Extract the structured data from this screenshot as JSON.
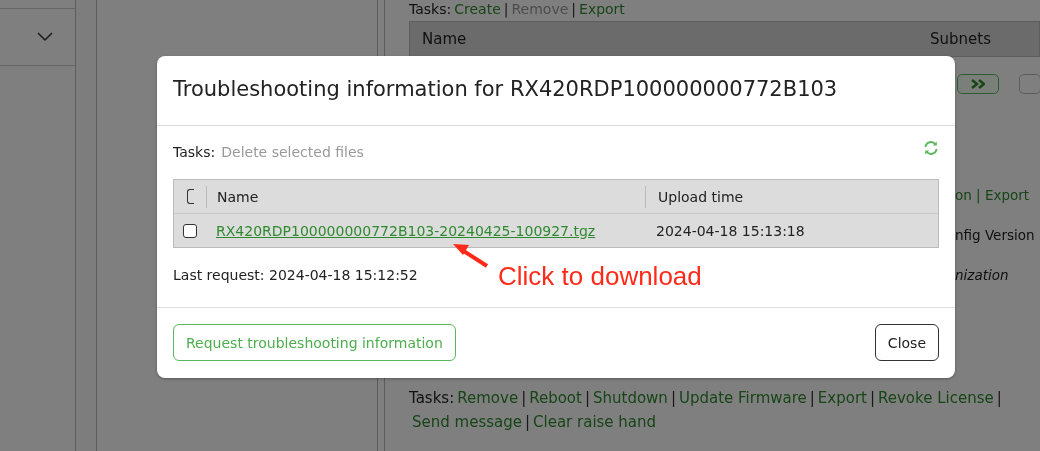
{
  "background": {
    "top_tasks": {
      "label": "Tasks:",
      "separator": "|",
      "items": [
        {
          "label": "Create",
          "disabled": false
        },
        {
          "label": "Remove",
          "disabled": true
        },
        {
          "label": "Export",
          "disabled": false
        }
      ]
    },
    "table": {
      "columns": [
        "Name",
        "Subnets"
      ]
    },
    "fragments": [
      {
        "kind": "link",
        "text": "on | Export"
      },
      {
        "kind": "heading",
        "text": "nfig Version"
      },
      {
        "kind": "italic",
        "text": "nization"
      }
    ],
    "tasks": {
      "label": "Tasks:",
      "separator": "|",
      "items": [
        "Remove",
        "Reboot",
        "Shutdown",
        "Update Firmware",
        "Export",
        "Revoke License",
        "Send message",
        "Clear raise hand"
      ]
    }
  },
  "dialog": {
    "title": "Troubleshooting information for RX420RDP100000000772B103",
    "tasks": {
      "label": "Tasks:",
      "items": [
        {
          "label": "Delete selected files",
          "disabled": true
        }
      ]
    },
    "table": {
      "select_all_checked": false,
      "columns": [
        "Name",
        "Upload time"
      ],
      "rows": [
        {
          "selected": false,
          "name": "RX420RDP100000000772B103-20240425-100927.tgz",
          "upload_time": "2024-04-18 15:13:18"
        }
      ]
    },
    "last_request": "Last request: 2024-04-18 15:12:52",
    "buttons": [
      {
        "kind": "primary",
        "label": "Request troubleshooting information"
      },
      {
        "kind": "default",
        "label": "Close"
      }
    ]
  },
  "annotation": {
    "text": "Click to download"
  }
}
